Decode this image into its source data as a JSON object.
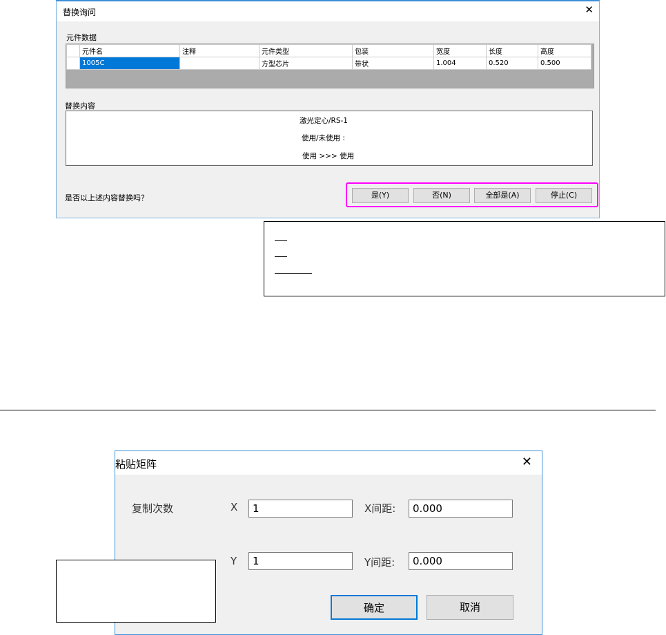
{
  "dialog1": {
    "title": "替换询问",
    "section1": "元件数据",
    "columns": [
      "元件名",
      "注释",
      "元件类型",
      "包装",
      "宽度",
      "长度",
      "高度"
    ],
    "row": [
      "1005C",
      "",
      "方型芯片",
      "带状",
      "1.004",
      "0.520",
      "0.500"
    ],
    "section2": "替换内容",
    "content": [
      "激光定心/RS-1",
      "使用/未使用 :",
      "使用 >>> 使用"
    ],
    "question": "是否以上述内容替换吗？",
    "buttons": {
      "yes": "是(Y)",
      "no": "否(N)",
      "all": "全部是(A)",
      "stop": "停止(C)"
    },
    "close": "✕",
    "highlight_color": "#ff00ff"
  },
  "dialog2": {
    "title": "粘贴矩阵",
    "close": "✕",
    "copy_count": "复制次数",
    "x_label": "X",
    "x_value": "1",
    "x_pitch_label": "X间距:",
    "x_pitch": "0.000",
    "y_label": "Y",
    "y_value": "1",
    "y_pitch_label": "Y间距:",
    "y_pitch": "0.000",
    "ok": "确定",
    "cancel": "取消"
  }
}
